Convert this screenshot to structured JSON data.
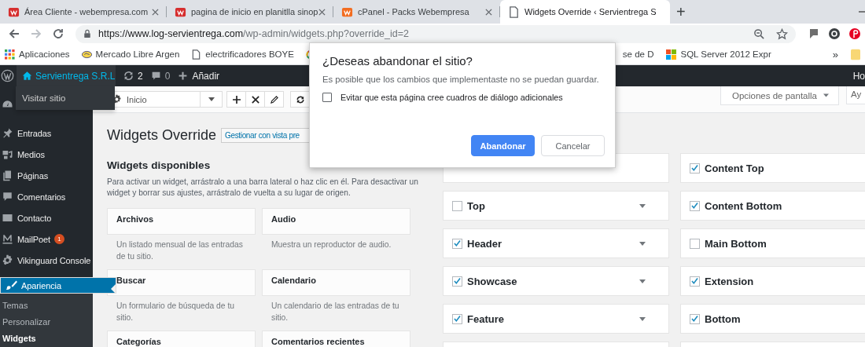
{
  "browser": {
    "tabs": [
      {
        "title": "Área Cliente - webempresa.com",
        "kind": "red",
        "selected": false
      },
      {
        "title": "pagina de inicio en planitlla sinop",
        "kind": "red",
        "selected": false
      },
      {
        "title": "cPanel - Packs Webempresa",
        "kind": "orange",
        "selected": false
      },
      {
        "title": "Widgets Override ‹ Servientrega S",
        "kind": "page",
        "selected": true
      }
    ],
    "new_tab": "+",
    "url": {
      "host": "https://www.log-servientrega.com",
      "path": "/wp-admin/widgets.php?override_id=2"
    },
    "bookmarks": [
      {
        "label": "Aplicaciones",
        "kind": "apps"
      },
      {
        "label": "Mercado Libre Argen",
        "kind": "handshake"
      },
      {
        "label": "electrificadores BOYE",
        "kind": "page"
      },
      {
        "kind": "google"
      }
    ],
    "bookmarks_right": [
      {
        "label": "se de D"
      },
      {
        "label": "SQL Server 2012 Expr",
        "kind": "squares"
      }
    ],
    "more": "»"
  },
  "admin_bar": {
    "site": "Servientrega S.R.L",
    "updates": "2",
    "comments": "0",
    "new": "Añadir",
    "right": "Ho",
    "site_menu": "Visitar sitio"
  },
  "sidebar": {
    "items": [
      {
        "kind": "dashboard",
        "selected": false
      },
      {
        "label": "Entradas",
        "kind": "pin",
        "selected": false
      },
      {
        "label": "Medios",
        "kind": "media",
        "selected": false
      },
      {
        "label": "Páginas",
        "kind": "pages",
        "selected": false
      },
      {
        "label": "Comentarios",
        "kind": "comment",
        "selected": false
      },
      {
        "label": "Contacto",
        "kind": "mail",
        "selected": false
      },
      {
        "label": "MailPoet",
        "kind": "zigzag",
        "badge": "1",
        "selected": false
      },
      {
        "label": "Vikinguard Console",
        "kind": "gear",
        "selected": false
      },
      {
        "label": "Apariencia",
        "kind": "brush",
        "selected": true
      }
    ],
    "submenu": [
      {
        "label": "Temas",
        "selected": false
      },
      {
        "label": "Personalizar",
        "selected": false
      },
      {
        "label": "Widgets",
        "selected": true
      }
    ]
  },
  "toolbar": {
    "select": "Inicio"
  },
  "screen_options": "Opciones de pantalla",
  "help": "Ay",
  "page": {
    "title": "Widgets Override",
    "manage_button": "Gestionar con vista pre"
  },
  "available": {
    "heading": "Widgets disponibles",
    "description": "Para activar un widget, arrástralo a una barra lateral o haz clic en él. Para desactivar un widget y borrar sus ajustes, arrástralo de vuelta a su lugar de origen.",
    "widgets": [
      {
        "name": "Archivos",
        "description": "Un listado mensual de las entradas de tu sitio."
      },
      {
        "name": "Audio",
        "description": "Muestra un reproductor de audio."
      },
      {
        "name": "Buscar",
        "description": "Un formulario de búsqueda de tu sitio."
      },
      {
        "name": "Calendario",
        "description": "Un calendario de las entradas de tu sitio."
      },
      {
        "name": "Categorías"
      },
      {
        "name": "Comentarios recientes"
      }
    ]
  },
  "sidebars": [
    [
      {
        "kind": "blank"
      },
      {
        "kind": "area",
        "name": "Top",
        "checked": false
      },
      {
        "kind": "area",
        "name": "Header",
        "checked": true
      },
      {
        "kind": "area",
        "name": "Showcase",
        "checked": true
      },
      {
        "kind": "area",
        "name": "Feature",
        "checked": true
      },
      {
        "kind": "blank"
      }
    ],
    [
      {
        "kind": "area",
        "name": "Content Top",
        "checked": true
      },
      {
        "kind": "area",
        "name": "Content Bottom",
        "checked": true
      },
      {
        "kind": "area",
        "name": "Main Bottom",
        "checked": false
      },
      {
        "kind": "area",
        "name": "Extension",
        "checked": true
      },
      {
        "kind": "area",
        "name": "Bottom",
        "checked": true
      },
      {
        "kind": "blank"
      }
    ]
  ],
  "dialog": {
    "title": "¿Deseas abandonar el sitio?",
    "message": "Es posible que los cambios que implementaste no se puedan guardar.",
    "checkbox": {
      "label": "Evitar que esta página cree cuadros de diálogo adicionales",
      "checked": false
    },
    "buttons": [
      {
        "label": "Abandonar",
        "kind": "primary"
      },
      {
        "label": "Cancelar",
        "kind": "secondary"
      }
    ]
  }
}
